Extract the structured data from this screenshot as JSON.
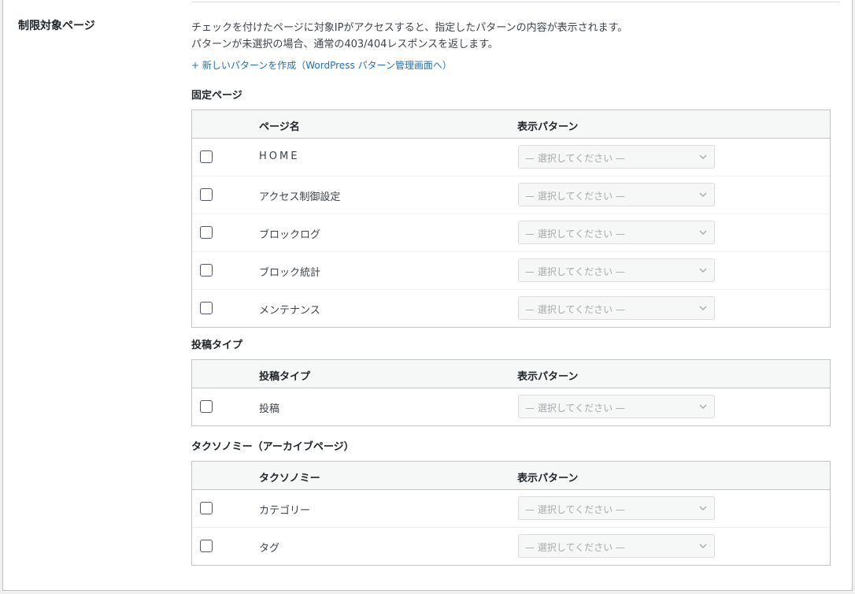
{
  "row_label": "制限対象ページ",
  "description": {
    "line1": "チェックを付けたページに対象IPがアクセスすると、指定したパターンの内容が表示されます。",
    "line2": "パターンが未選択の場合、通常の403/404レスポンスを返します。"
  },
  "new_pattern_link": "+ 新しいパターンを作成（WordPress パターン管理画面へ）",
  "select_placeholder": "— 選択してください —",
  "icons": {
    "select_arrow": "chevron-down-icon"
  },
  "colors": {
    "link": "#2271b1",
    "border": "#c3c4c7",
    "header_bg": "#f6f7f7"
  },
  "sections": [
    {
      "title": "固定ページ",
      "col_name": "ページ名",
      "col_pattern": "表示パターン",
      "rows": [
        "HOME",
        "アクセス制御設定",
        "ブロックログ",
        "ブロック統計",
        "メンテナンス"
      ]
    },
    {
      "title": "投稿タイプ",
      "col_name": "投稿タイプ",
      "col_pattern": "表示パターン",
      "rows": [
        "投稿"
      ]
    },
    {
      "title": "タクソノミー（アーカイブページ）",
      "col_name": "タクソノミー",
      "col_pattern": "表示パターン",
      "rows": [
        "カテゴリー",
        "タグ"
      ]
    }
  ]
}
